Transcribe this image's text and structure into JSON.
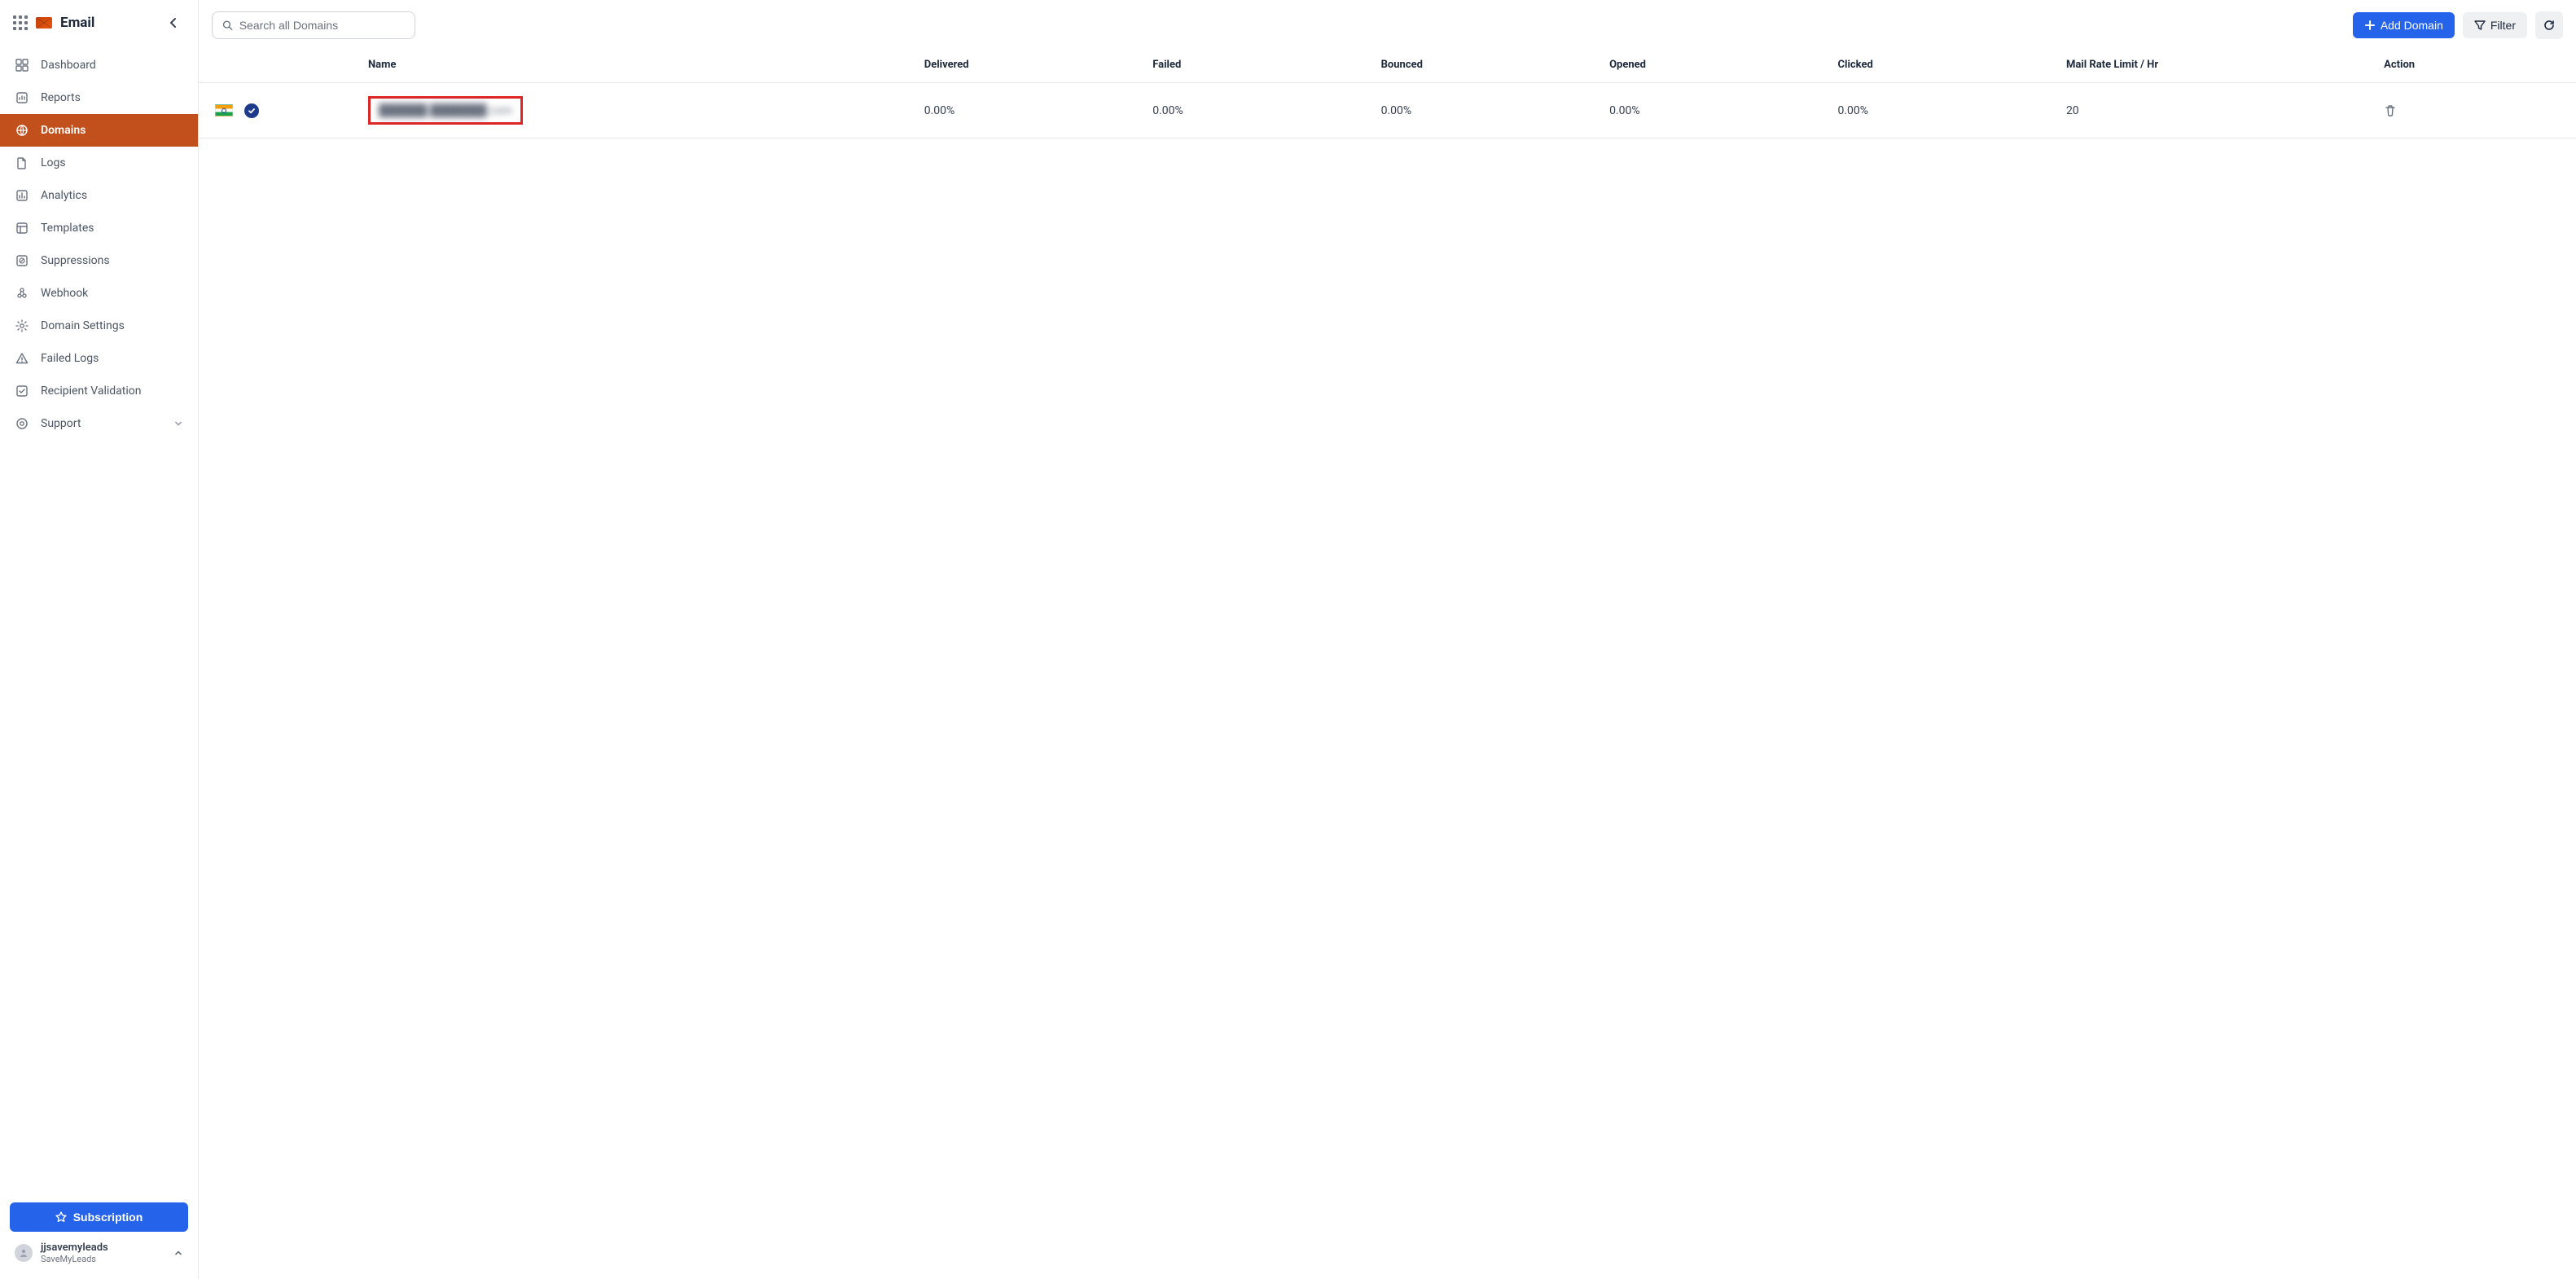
{
  "app": {
    "title": "Email"
  },
  "sidebar": {
    "items": [
      {
        "label": "Dashboard"
      },
      {
        "label": "Reports"
      },
      {
        "label": "Domains"
      },
      {
        "label": "Logs"
      },
      {
        "label": "Analytics"
      },
      {
        "label": "Templates"
      },
      {
        "label": "Suppressions"
      },
      {
        "label": "Webhook"
      },
      {
        "label": "Domain Settings"
      },
      {
        "label": "Failed Logs"
      },
      {
        "label": "Recipient Validation"
      },
      {
        "label": "Support"
      }
    ],
    "subscription_label": "Subscription",
    "user": {
      "name": "jjsavemyleads",
      "org": "SaveMyLeads"
    }
  },
  "toolbar": {
    "search_placeholder": "Search all Domains",
    "add_domain_label": "Add Domain",
    "filter_label": "Filter"
  },
  "table": {
    "headers": {
      "name": "Name",
      "delivered": "Delivered",
      "failed": "Failed",
      "bounced": "Bounced",
      "opened": "Opened",
      "clicked": "Clicked",
      "rate": "Mail Rate Limit / Hr",
      "action": "Action"
    },
    "rows": [
      {
        "flag_country": "India",
        "verified": true,
        "name_obscured": "██████.███████.com",
        "delivered": "0.00%",
        "failed": "0.00%",
        "bounced": "0.00%",
        "opened": "0.00%",
        "clicked": "0.00%",
        "rate": "20"
      }
    ]
  }
}
